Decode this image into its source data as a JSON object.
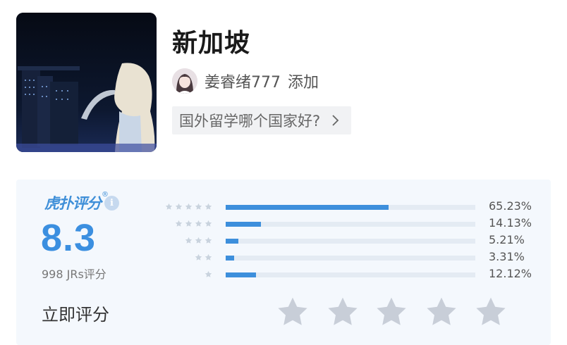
{
  "header": {
    "title": "新加坡",
    "author_name": "姜睿绪777",
    "author_action": "添加",
    "topic_tag": "国外留学哪个国家好?"
  },
  "rating": {
    "brand_logo_text": "虎扑评分",
    "brand_logo_mark": "®",
    "info_symbol": "i",
    "score": "8.3",
    "count_text": "998 JRs评分",
    "rate_prompt": "立即评分",
    "distribution": [
      {
        "stars": 5,
        "percent": 65.23,
        "label": "65.23%"
      },
      {
        "stars": 4,
        "percent": 14.13,
        "label": "14.13%"
      },
      {
        "stars": 3,
        "percent": 5.21,
        "label": "5.21%"
      },
      {
        "stars": 2,
        "percent": 3.31,
        "label": "3.31%"
      },
      {
        "stars": 1,
        "percent": 12.12,
        "label": "12.12%"
      }
    ]
  },
  "colors": {
    "accent": "#3d8fdc",
    "panel_bg": "#f4f8fd",
    "star_empty": "#c8ced8",
    "track": "#e4ebf3"
  },
  "icons": [
    "merlion-cover-image",
    "user-avatar",
    "chevron-right-icon",
    "info-icon",
    "star-icon"
  ]
}
